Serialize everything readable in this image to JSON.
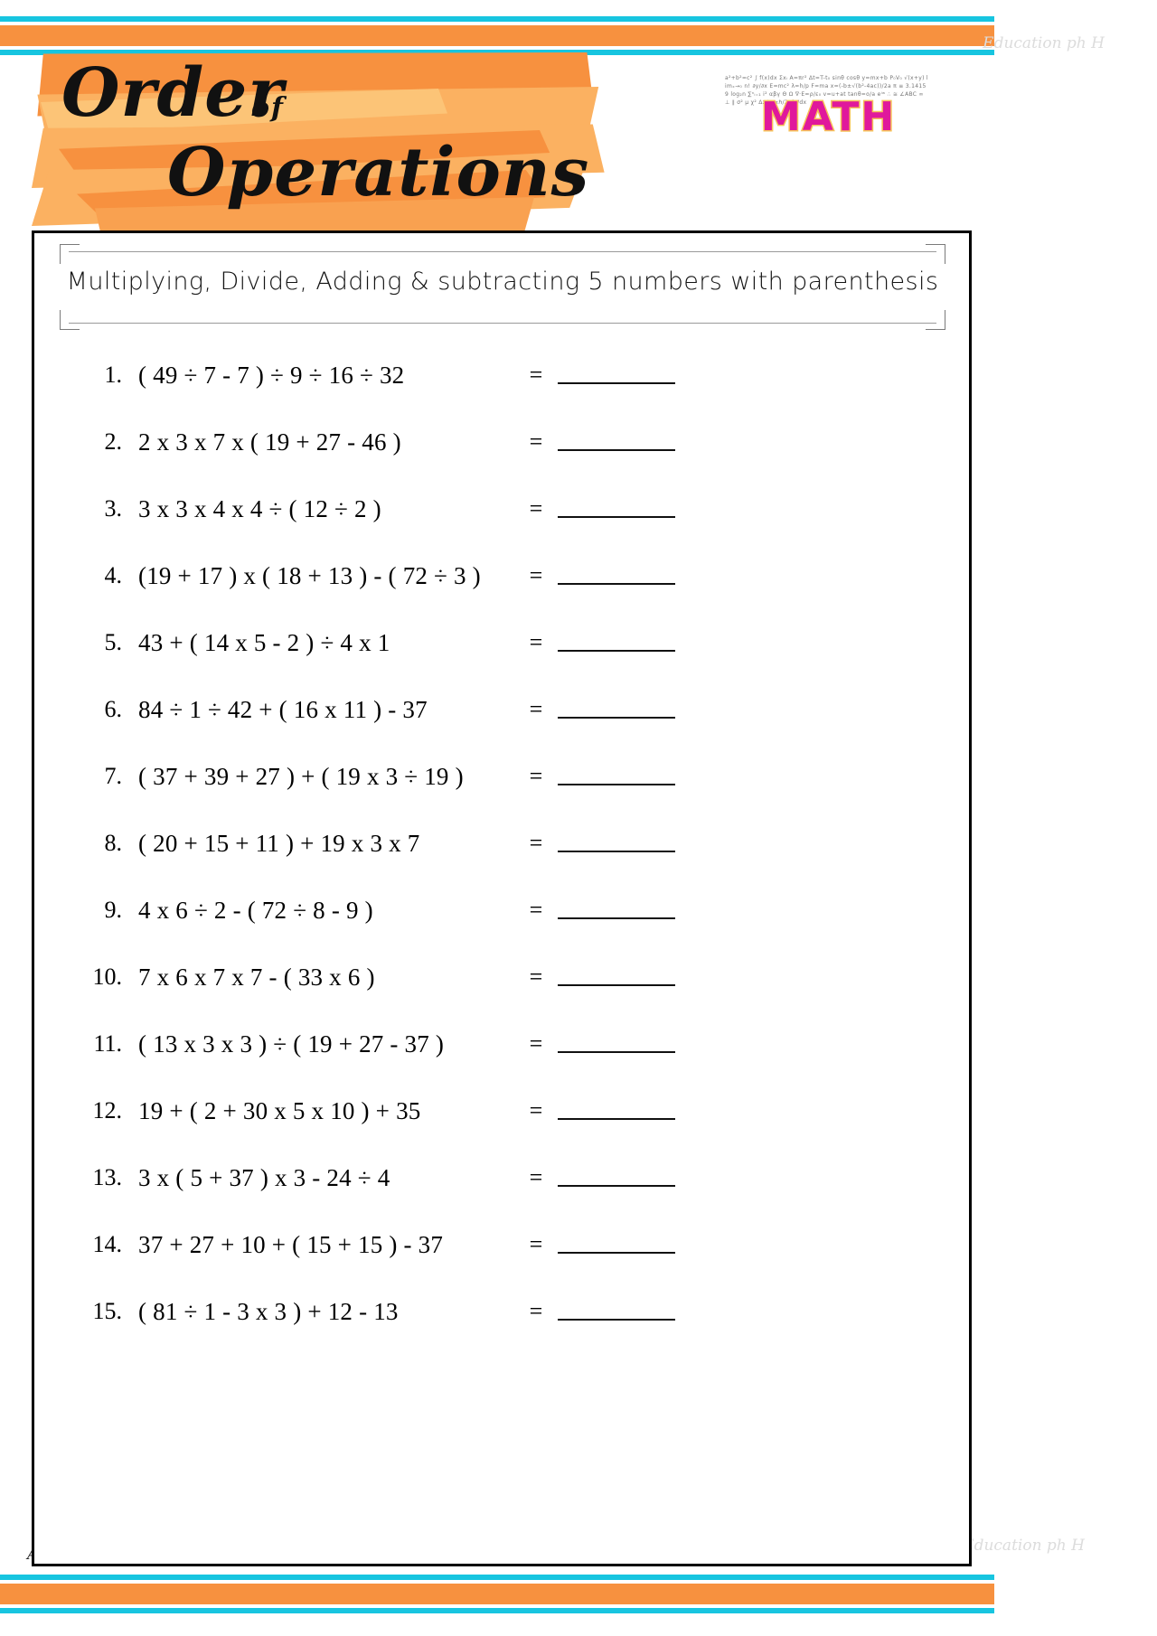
{
  "header": {
    "title_line1": "Order",
    "title_of": "of",
    "title_line2": "Operations",
    "logo_word": "MATH",
    "logo_formula_text": "a²+b²=c² ∫ f(x)dx Σxᵢ A=πr² Δt=T-t₀ sinθ cosθ y=mx+b P₀V₀ √(x+y) limₓ→₀ n! ∂y/∂x E=mc² λ=h/p F=ma x=(-b±√(b²-4ac))/2a π ≡ 3.14159 log₂n ∑ⁿᵢ₌₁ i² αβγ Θ Ω ∇·E=ρ/ε₀ v=u+at tanθ=o/a eⁱʷ ∴ ≅ ∠ABC ∞ ⊥ ∥ σ² μ χ² ΔxΔp≥ℏ/2 dy/dx",
    "watermark_top": "Education ph H",
    "watermark_bottom": "Education ph H",
    "signature": "Athena"
  },
  "worksheet": {
    "subtitle": "Multiplying, Divide, Adding & subtracting 5 numbers with parenthesis",
    "equals_sign": "=",
    "problems": [
      {
        "num": "1.",
        "expr": "( 49 ÷ 7 - 7 ) ÷ 9 ÷ 16 ÷ 32"
      },
      {
        "num": "2.",
        "expr": "2 x 3 x 7 x ( 19 + 27 - 46 )"
      },
      {
        "num": "3.",
        "expr": "3 x 3 x 4 x 4 ÷ ( 12 ÷ 2 )"
      },
      {
        "num": "4.",
        "expr": "(19 + 17 ) x ( 18 + 13 ) - ( 72 ÷ 3 )"
      },
      {
        "num": "5.",
        "expr": "43 + ( 14 x 5 - 2 ) ÷ 4 x 1"
      },
      {
        "num": "6.",
        "expr": "84 ÷ 1 ÷ 42 + ( 16 x 11 ) - 37"
      },
      {
        "num": "7.",
        "expr": "( 37 + 39 + 27 ) + ( 19 x 3 ÷ 19 )"
      },
      {
        "num": "8.",
        "expr": "( 20 + 15 + 11 ) + 19 x 3 x 7"
      },
      {
        "num": "9.",
        "expr": "4 x 6 ÷ 2 - ( 72 ÷ 8 - 9 )"
      },
      {
        "num": "10.",
        "expr": "7 x 6 x 7 x 7 - ( 33 x 6 )"
      },
      {
        "num": "11.",
        "expr": "( 13 x 3 x 3 ) ÷ ( 19 + 27 - 37 )"
      },
      {
        "num": "12.",
        "expr": "19 + ( 2 + 30 x 5 x 10 ) + 35"
      },
      {
        "num": "13.",
        "expr": "3 x ( 5 + 37 ) x 3 - 24 ÷ 4"
      },
      {
        "num": "14.",
        "expr": "37 + 27 + 10 + ( 15 + 15 ) - 37"
      },
      {
        "num": "15.",
        "expr": "( 81 ÷ 1 - 3 x 3 ) + 12 - 13"
      }
    ]
  },
  "colors": {
    "ribbon_cyan": "#17c5e0",
    "ribbon_orange": "#f7913f",
    "banner_orange_dark": "#f7913f",
    "banner_orange_light": "#fbb161",
    "logo_pink": "#e0189c",
    "logo_outline": "#f6c158",
    "frame_black": "#000000"
  }
}
